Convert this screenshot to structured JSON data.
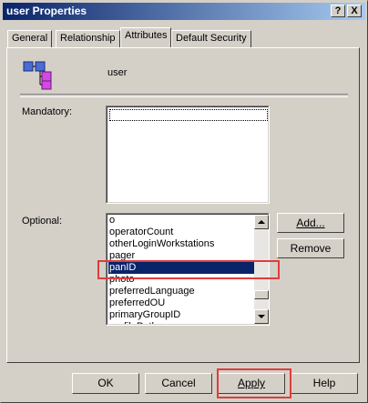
{
  "window": {
    "title": "user Properties",
    "help_btn": "?",
    "close_btn": "X"
  },
  "tabs": [
    {
      "label": "General"
    },
    {
      "label": "Relationship"
    },
    {
      "label": "Attributes"
    },
    {
      "label": "Default Security"
    }
  ],
  "header": {
    "class_name": "user",
    "icon": "class-hierarchy-icon"
  },
  "mandatory": {
    "label": "Mandatory:",
    "items": []
  },
  "optional": {
    "label": "Optional:",
    "items": [
      "o",
      "operatorCount",
      "otherLoginWorkstations",
      "pager",
      "panID",
      "photo",
      "preferredLanguage",
      "preferredOU",
      "primaryGroupID",
      "profilePath"
    ],
    "selected": "panID"
  },
  "buttons": {
    "add": "Add...",
    "remove": "Remove",
    "ok": "OK",
    "cancel": "Cancel",
    "apply": "Apply",
    "help": "Help"
  },
  "colors": {
    "titlebar_start": "#0a246a",
    "selection": "#0a246a",
    "annotation": "#e03c3c"
  }
}
